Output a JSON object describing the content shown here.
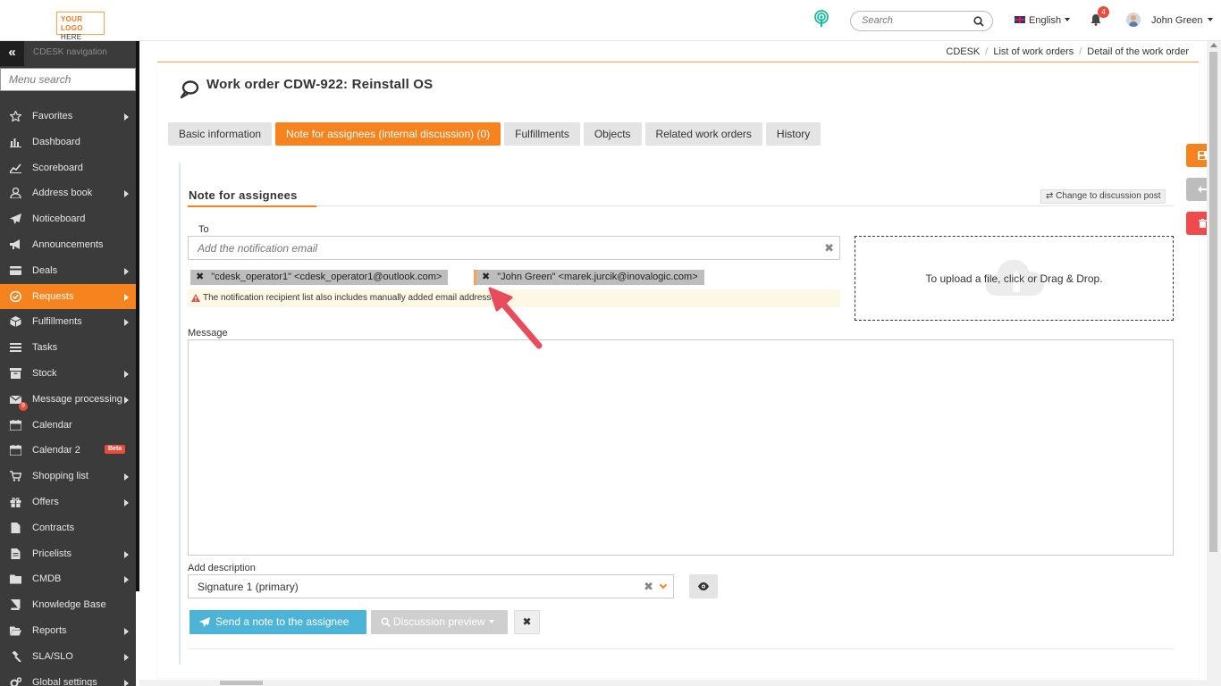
{
  "topbar": {
    "logo_line1": "YOUR LOGO",
    "logo_line2": "HERE",
    "search_placeholder": "Search",
    "language": "English",
    "notifications_count": "4",
    "user_name": "John Green"
  },
  "sidebar": {
    "collapse_glyph": "«",
    "nav_title": "CDESK navigation",
    "menu_search_placeholder": "Menu search",
    "items": [
      {
        "label": "Favorites",
        "icon": "star-icon",
        "submenu": true
      },
      {
        "label": "Dashboard",
        "icon": "bar-chart-icon",
        "submenu": false
      },
      {
        "label": "Scoreboard",
        "icon": "line-chart-icon",
        "submenu": false
      },
      {
        "label": "Address book",
        "icon": "user-icon",
        "submenu": true
      },
      {
        "label": "Noticeboard",
        "icon": "paper-plane-icon",
        "submenu": false
      },
      {
        "label": "Announcements",
        "icon": "bullhorn-icon",
        "submenu": false
      },
      {
        "label": "Deals",
        "icon": "card-icon",
        "submenu": true
      },
      {
        "label": "Requests",
        "icon": "check-circle-icon",
        "submenu": true,
        "active": true
      },
      {
        "label": "Fulfillments",
        "icon": "cube-icon",
        "submenu": true
      },
      {
        "label": "Tasks",
        "icon": "tasks-icon",
        "submenu": false
      },
      {
        "label": "Stock",
        "icon": "archive-icon",
        "submenu": true
      },
      {
        "label": "Message processing",
        "icon": "envelope-icon",
        "submenu": true,
        "badge": "9"
      },
      {
        "label": "Calendar",
        "icon": "calendar-icon",
        "submenu": false
      },
      {
        "label": "Calendar 2",
        "icon": "calendar-icon",
        "submenu": false,
        "tag": "Beta"
      },
      {
        "label": "Shopping list",
        "icon": "cart-icon",
        "submenu": true
      },
      {
        "label": "Offers",
        "icon": "gift-icon",
        "submenu": true
      },
      {
        "label": "Contracts",
        "icon": "file-icon",
        "submenu": false
      },
      {
        "label": "Pricelists",
        "icon": "file-text-icon",
        "submenu": true
      },
      {
        "label": "CMDB",
        "icon": "folder-icon",
        "submenu": true
      },
      {
        "label": "Knowledge Base",
        "icon": "book-icon",
        "submenu": false
      },
      {
        "label": "Reports",
        "icon": "folder-open-icon",
        "submenu": true
      },
      {
        "label": "SLA/SLO",
        "icon": "gavel-icon",
        "submenu": true
      },
      {
        "label": "Global settings",
        "icon": "cogs-icon",
        "submenu": true
      }
    ]
  },
  "breadcrumb": [
    "CDESK",
    "List of work orders",
    "Detail of the work order"
  ],
  "page": {
    "title": "Work order CDW-922: Reinstall OS",
    "tabs": [
      {
        "label": "Basic information",
        "active": false
      },
      {
        "label": "Note for assignees (internal discussion) (0)",
        "active": true
      },
      {
        "label": "Fulfillments",
        "active": false
      },
      {
        "label": "Objects",
        "active": false
      },
      {
        "label": "Related work orders",
        "active": false
      },
      {
        "label": "History",
        "active": false
      }
    ]
  },
  "note": {
    "section_title": "Note for assignees",
    "switch_link": "Change to discussion post",
    "to_label": "To",
    "to_placeholder": "Add the notification email",
    "recipients": [
      "\"cdesk_operator1\" <cdesk_operator1@outlook.com>",
      "\"John Green\" <marek.jurcik@inovalogic.com>"
    ],
    "warning": "The notification recipient list also includes manually added email addresses",
    "upload_text": "To upload a file, click or Drag & Drop.",
    "message_label": "Message",
    "description_label": "Add description",
    "description_value": "Signature 1 (primary)",
    "send_button": "Send a note to the assignee",
    "preview_button": "Discussion preview",
    "cancel_glyph": "✖"
  },
  "colors": {
    "accent": "#f7831f",
    "sidebar_bg": "#3b3b3b",
    "send_button": "#4db4d7",
    "danger": "#ef4b4b"
  }
}
